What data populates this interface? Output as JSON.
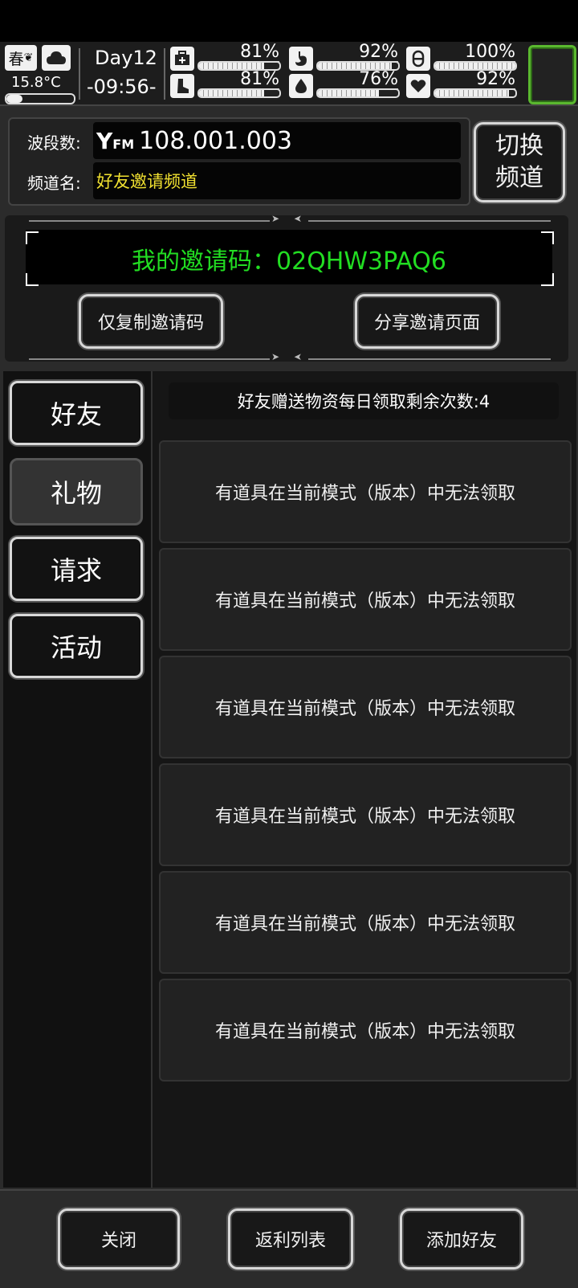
{
  "status": {
    "season": "春",
    "temperature": "15.8°C",
    "temperature_level": 0.25,
    "day": "Day12",
    "time": "-09:56-",
    "stats": [
      {
        "icon": "medkit-icon",
        "pct": "81%",
        "level": 0.81
      },
      {
        "icon": "stomach-icon",
        "pct": "92%",
        "level": 0.92
      },
      {
        "icon": "pill-icon",
        "pct": "100%",
        "level": 1.0
      },
      {
        "icon": "boot-icon",
        "pct": "81%",
        "level": 0.81
      },
      {
        "icon": "water-drop-icon",
        "pct": "76%",
        "level": 0.76
      },
      {
        "icon": "heart-icon",
        "pct": "92%",
        "level": 0.92
      }
    ]
  },
  "channel": {
    "band_label": "波段数:",
    "band_value": "108.001.003",
    "name_label": "频道名:",
    "name_value": "好友邀请频道",
    "switch_label_1": "切换",
    "switch_label_2": "频道"
  },
  "invite": {
    "code_text": "我的邀请码：02QHW3PAQ6",
    "copy_button": "仅复制邀请码",
    "share_button": "分享邀请页面"
  },
  "tabs": [
    {
      "label": "好友",
      "active": false
    },
    {
      "label": "礼物",
      "active": true
    },
    {
      "label": "请求",
      "active": false
    },
    {
      "label": "活动",
      "active": false
    }
  ],
  "gifts": {
    "info": "好友赠送物资每日领取剩余次数:4",
    "items": [
      "有道具在当前模式（版本）中无法领取",
      "有道具在当前模式（版本）中无法领取",
      "有道具在当前模式（版本）中无法领取",
      "有道具在当前模式（版本）中无法领取",
      "有道具在当前模式（版本）中无法领取",
      "有道具在当前模式（版本）中无法领取"
    ]
  },
  "bottom": {
    "close": "关闭",
    "rebate": "返利列表",
    "add_friend": "添加好友"
  },
  "colors": {
    "accent_green": "#22dd22",
    "channel_name_yellow": "#f0e030",
    "status_green": "#5ab82f"
  }
}
